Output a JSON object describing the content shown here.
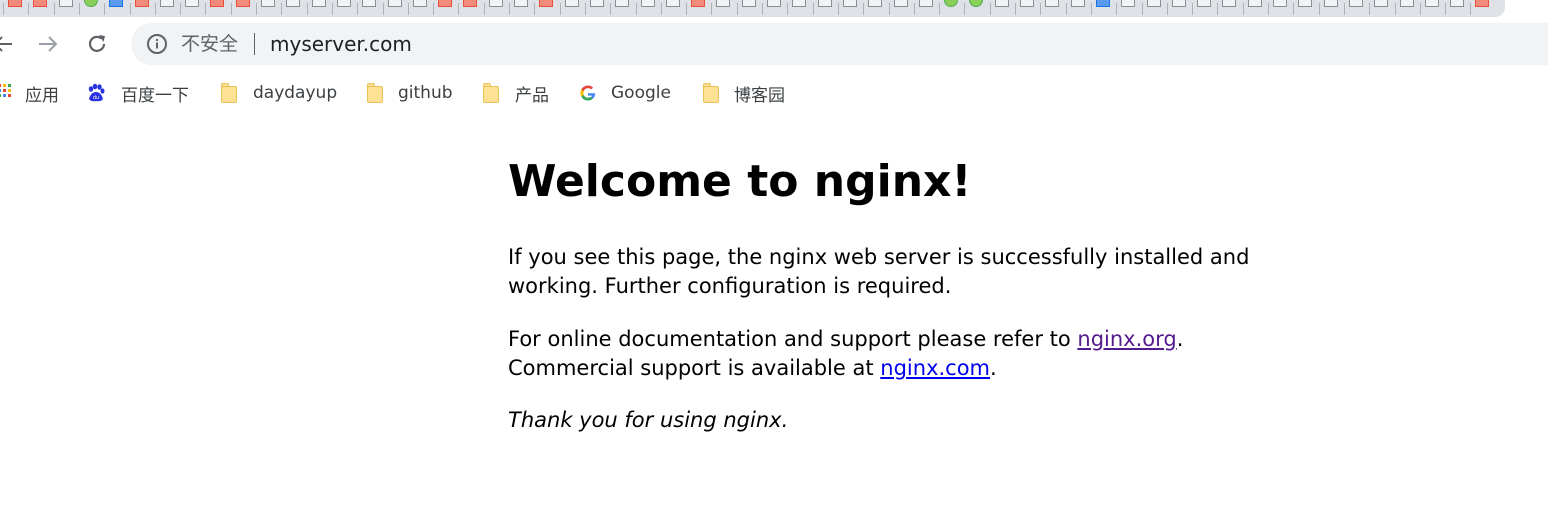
{
  "browser": {
    "address_bar": {
      "security_label": "不安全",
      "url": "myserver.com"
    },
    "bookmarks": [
      {
        "label": "应用",
        "icon": "apps-grid-icon"
      },
      {
        "label": "百度一下",
        "icon": "baidu-paw-icon"
      },
      {
        "label": "daydayup",
        "icon": "folder-icon"
      },
      {
        "label": "github",
        "icon": "folder-icon"
      },
      {
        "label": "产品",
        "icon": "folder-icon"
      },
      {
        "label": "Google",
        "icon": "google-g-icon"
      },
      {
        "label": "博客园",
        "icon": "folder-icon"
      }
    ]
  },
  "page": {
    "heading": "Welcome to nginx!",
    "paragraph1": "If you see this page, the nginx web server is successfully installed and working. Further configuration is required.",
    "paragraph2_prefix": "For online documentation and support please refer to ",
    "link_org": "nginx.org",
    "paragraph2_mid": ".",
    "paragraph2_line2": "Commercial support is available at ",
    "link_com": "nginx.com",
    "paragraph2_end": ".",
    "thanks": "Thank you for using nginx."
  },
  "colors": {
    "visited_link": "#551a8b",
    "link": "#0000ee",
    "folder": "#fde293",
    "omnibox_bg": "#f1f3f4",
    "tabstrip_bg": "#dee1e6"
  }
}
